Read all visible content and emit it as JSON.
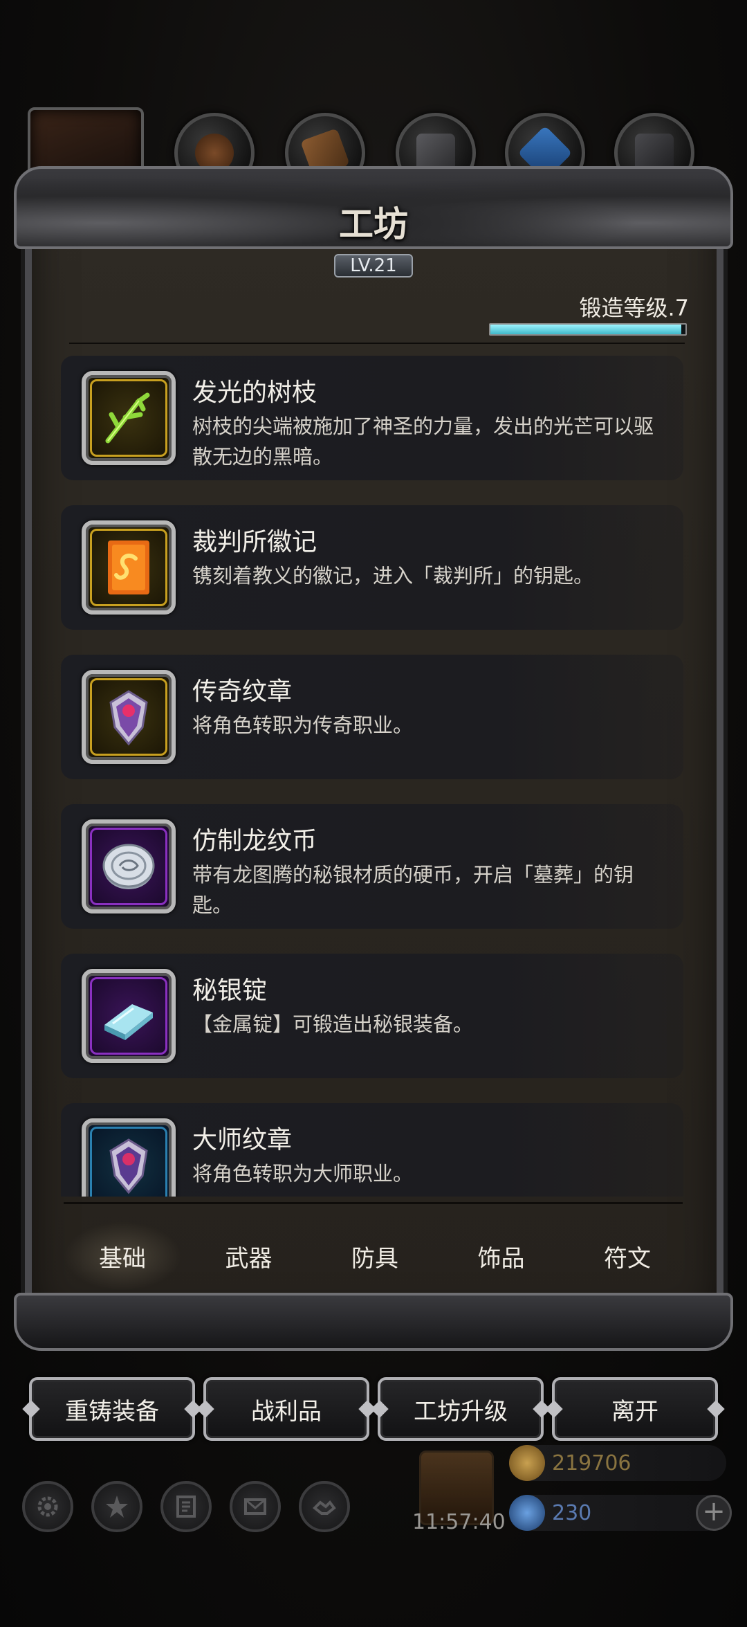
{
  "workshop": {
    "title": "工坊",
    "level": "LV.21",
    "forge_level_label": "锻造等级.7",
    "forge_progress": 0.98
  },
  "items": [
    {
      "name": "发光的树枝",
      "desc": "树枝的尖端被施加了神圣的力量，发出的光芒可以驱散无边的黑暗。",
      "rarity": "gold",
      "icon": "glowing-branch-icon"
    },
    {
      "name": "裁判所徽记",
      "desc": "镌刻着教义的徽记，进入「裁判所」的钥匙。",
      "rarity": "gold",
      "icon": "inquisition-sigil-icon"
    },
    {
      "name": "传奇纹章",
      "desc": "将角色转职为传奇职业。",
      "rarity": "gold",
      "icon": "legendary-crest-icon"
    },
    {
      "name": "仿制龙纹币",
      "desc": "带有龙图腾的秘银材质的硬币，开启「墓葬」的钥匙。",
      "rarity": "purple",
      "icon": "dragon-coin-icon"
    },
    {
      "name": "秘银锭",
      "desc": "【金属锭】可锻造出秘银装备。",
      "rarity": "purple",
      "icon": "mithril-ingot-icon"
    },
    {
      "name": "大师纹章",
      "desc": "将角色转职为大师职业。",
      "rarity": "blue",
      "icon": "master-crest-icon"
    }
  ],
  "tabs": [
    "基础",
    "武器",
    "防具",
    "饰品",
    "符文"
  ],
  "active_tab": 0,
  "buttons": {
    "reforge": "重铸装备",
    "loot": "战利品",
    "upgrade": "工坊升级",
    "leave": "离开"
  },
  "hud": {
    "timer": "11:57:40",
    "gold": "219706",
    "gems": "230",
    "plus": "+"
  },
  "colors": {
    "progress_fill": "#3fb8c8",
    "gold_text": "#8a7440",
    "gem_text": "#5a7ab0"
  }
}
